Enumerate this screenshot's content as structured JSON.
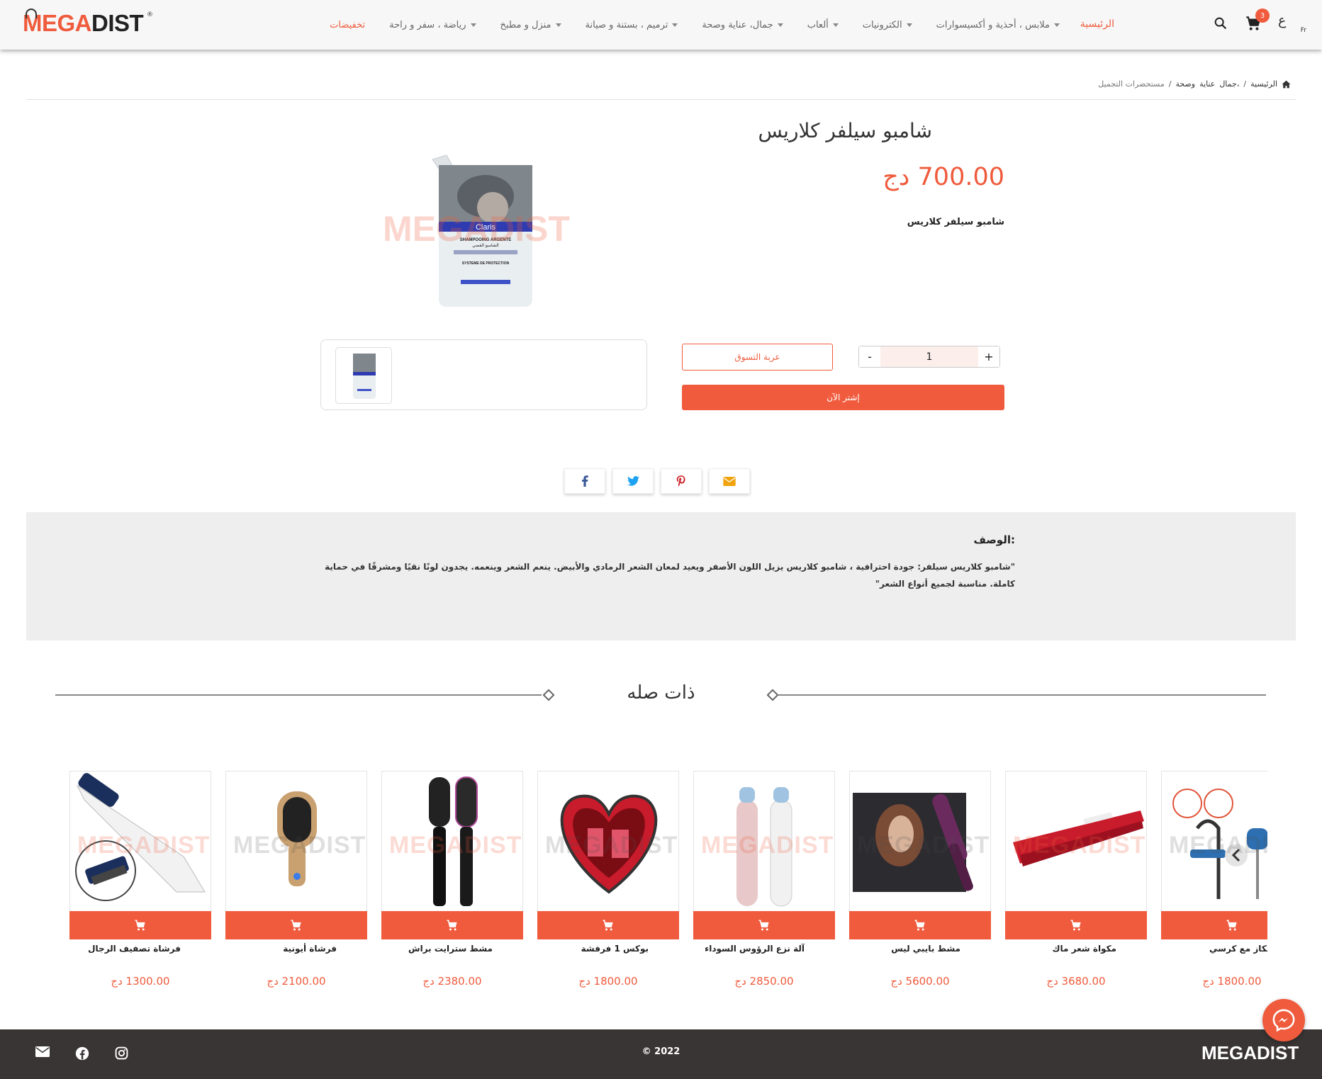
{
  "header": {
    "logo_part1": "MEGA",
    "logo_part2": "DIST",
    "logo_reg": "®",
    "nav": {
      "home": "الرئيسية",
      "items": [
        "ملابس ، أحذية و أكسيسوارات",
        "الكترونيات",
        "ألعاب",
        "جمال، عناية وصحة",
        "ترميم ، بستنة و صيانة",
        "منزل و مطبخ",
        "رياضة ، سفر و راحة"
      ],
      "sale": "تخفيضات"
    },
    "cart_count": "3",
    "lang_ar": "ع",
    "lang_fr": "Fr"
  },
  "breadcrumb": {
    "home": "الرئيسية",
    "sep": "/",
    "cat1": "جمال،",
    "cat2": "عناية",
    "cat3": "وصحة",
    "current": "مستحضرات التجميل"
  },
  "product": {
    "title": "شامبو سيلفر كلاريس",
    "price": "700.00 دج",
    "short_desc": "شامبو سيلفر كلاريس",
    "qty": "1",
    "qty_minus": "-",
    "qty_plus": "+",
    "cart_label": "عربة التسوق",
    "buy_label": "إشتر الآن",
    "pack_brand": "Claris",
    "pack_line1": "SHAMPOOING ARGENTE",
    "pack_line2": "الشامبو الفضي",
    "pack_line3": "SYSTEME DE PROTECTION"
  },
  "description": {
    "title": "الوصف:",
    "text": "\"شامبو كلاريس سيلفر: جودة احترافية ، شامبو كلاريس يزيل اللون الأصفر ويعيد لمعان الشعر الرمادي والأبيض. ينعم الشعر وينعمه. يجدون لونًا نقيًا ومشرقًا في حماية كاملة. مناسبة لجميع أنواع الشعر\""
  },
  "related": {
    "title": "ذات صله",
    "watermark": "MEGADIST",
    "products": [
      {
        "name": "فرشاة تصفيف الرجال",
        "price": "1300.00 دج"
      },
      {
        "name": "فرشاة أيونية",
        "price": "2100.00 دج"
      },
      {
        "name": "مشط سترايت براش",
        "price": "2380.00 دج"
      },
      {
        "name": "بوكس 1 فرفشة",
        "price": "1800.00 دج"
      },
      {
        "name": "آلة نزع الرؤوس السوداء",
        "price": "2850.00 دج"
      },
      {
        "name": "مشط بايبي ليس",
        "price": "5600.00 دج"
      },
      {
        "name": "مكواة شعر ماك",
        "price": "3680.00 دج"
      },
      {
        "name": "عكاز مع كرسي",
        "price": "1800.00 دج"
      }
    ]
  },
  "footer": {
    "copyright": "© 2022",
    "logo": "MEGADIST"
  },
  "colors": {
    "accent": "#ef5b3c",
    "footer_bg": "#3a3535",
    "desc_bg": "#eeeeee"
  }
}
